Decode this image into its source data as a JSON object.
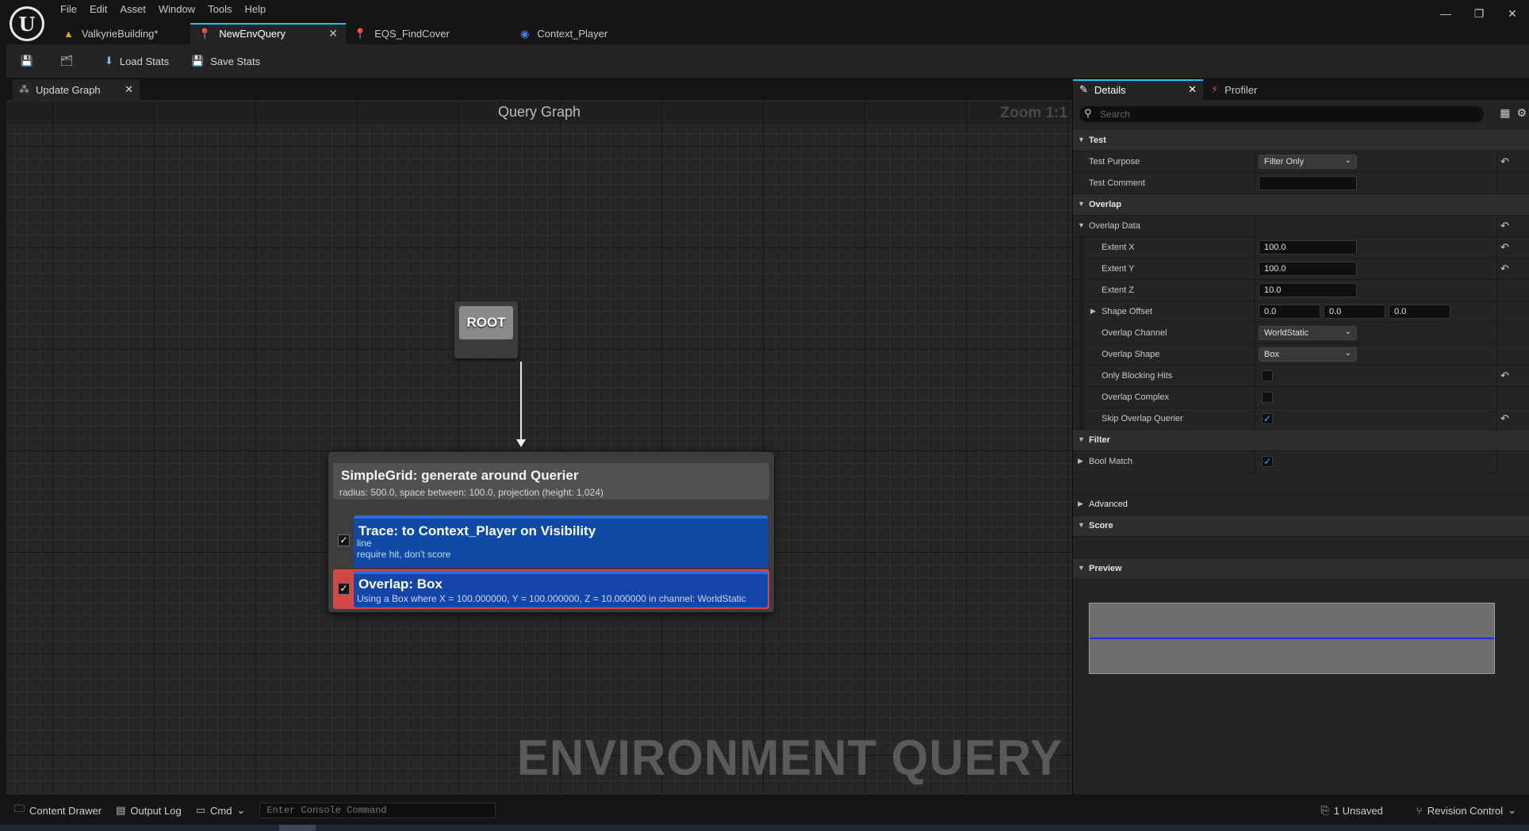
{
  "menu": [
    "File",
    "Edit",
    "Asset",
    "Window",
    "Tools",
    "Help"
  ],
  "window_controls": {
    "minimize": "—",
    "restore": "❐",
    "close": "✕"
  },
  "doc_tabs": [
    {
      "label": "ValkyrieBuilding*",
      "icon": "level-icon",
      "active": false
    },
    {
      "label": "NewEnvQuery",
      "icon": "env-query-icon",
      "active": true
    },
    {
      "label": "EQS_FindCover",
      "icon": "env-query-icon",
      "active": false
    },
    {
      "label": "Context_Player",
      "icon": "blueprint-icon",
      "active": false
    }
  ],
  "toolbar": {
    "load_stats": "Load Stats",
    "save_stats": "Save Stats"
  },
  "graph_panel": {
    "tab_label": "Update Graph",
    "title": "Query Graph",
    "zoom": "Zoom 1:1",
    "watermark": "ENVIRONMENT QUERY",
    "root_label": "ROOT",
    "generator": {
      "title": "SimpleGrid: generate around Querier",
      "subtitle": "radius: 500.0, space between: 100.0, projection (height: 1,024)"
    },
    "tests": [
      {
        "title": "Trace: to Context_Player on Visibility",
        "lines": [
          "line",
          "require hit, don't score"
        ],
        "checked": true
      },
      {
        "title": "Overlap: Box",
        "lines": [
          "Using a Box where X = 100.000000, Y = 100.000000, Z = 10.000000 in channel: WorldStatic"
        ],
        "checked": true,
        "selected": true
      }
    ]
  },
  "details_panel": {
    "tab_details": "Details",
    "tab_profiler": "Profiler",
    "search_placeholder": "Search",
    "sections": {
      "test": "Test",
      "overlap": "Overlap",
      "filter": "Filter",
      "advanced": "Advanced",
      "score": "Score",
      "preview": "Preview"
    },
    "props": {
      "test_purpose": {
        "label": "Test Purpose",
        "value": "Filter Only"
      },
      "test_comment": {
        "label": "Test Comment",
        "value": ""
      },
      "overlap_data": {
        "label": "Overlap Data"
      },
      "extent_x": {
        "label": "Extent X",
        "value": "100.0"
      },
      "extent_y": {
        "label": "Extent Y",
        "value": "100.0"
      },
      "extent_z": {
        "label": "Extent Z",
        "value": "10.0"
      },
      "shape_offset": {
        "label": "Shape Offset",
        "x": "0.0",
        "y": "0.0",
        "z": "0.0"
      },
      "overlap_channel": {
        "label": "Overlap Channel",
        "value": "WorldStatic"
      },
      "overlap_shape": {
        "label": "Overlap Shape",
        "value": "Box"
      },
      "only_blocking_hits": {
        "label": "Only Blocking Hits",
        "checked": false
      },
      "overlap_complex": {
        "label": "Overlap Complex",
        "checked": false
      },
      "skip_overlap_querier": {
        "label": "Skip Overlap Querier",
        "checked": true
      },
      "bool_match": {
        "label": "Bool Match",
        "checked": true
      }
    }
  },
  "statusbar": {
    "content_drawer": "Content Drawer",
    "output_log": "Output Log",
    "cmd": "Cmd",
    "console_placeholder": "Enter Console Command",
    "unsaved": "1 Unsaved",
    "revision_control": "Revision Control"
  },
  "colors": {
    "accent": "#26bbff",
    "test_node": "#0e4aa6",
    "selection": "#d24848"
  }
}
